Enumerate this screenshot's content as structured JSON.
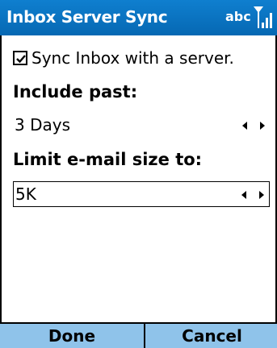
{
  "titlebar": {
    "title": "Inbox Server Sync",
    "input_mode": "abc",
    "signal_icon": "signal-strength-icon"
  },
  "sync_checkbox": {
    "label": "Sync Inbox with a server.",
    "checked": true
  },
  "include_past": {
    "label": "Include past:",
    "value": "3 Days"
  },
  "limit_size": {
    "label": "Limit e-mail size to:",
    "value": "5K"
  },
  "softkeys": {
    "left": "Done",
    "right": "Cancel"
  },
  "colors": {
    "titlebar": "#0b74c4",
    "softkey_bar": "#8fc3ea"
  }
}
